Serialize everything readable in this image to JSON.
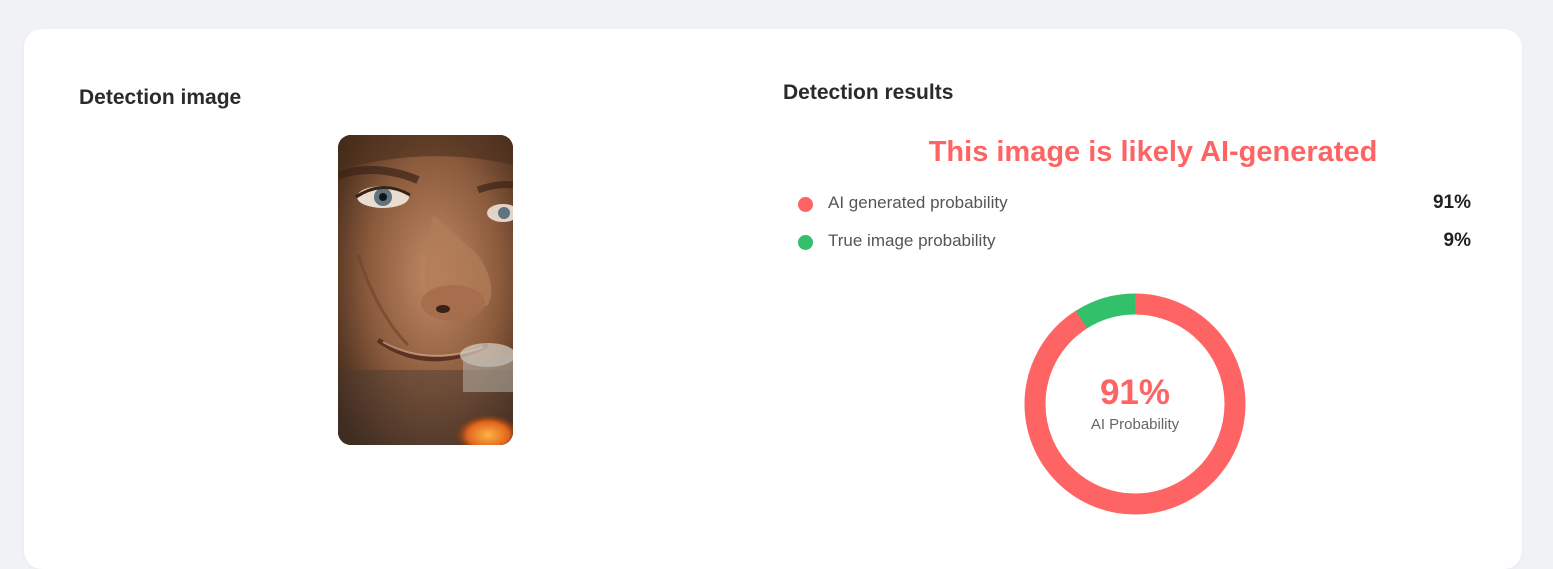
{
  "left_panel": {
    "title": "Detection image",
    "image_icon": "portrait-photo-icon"
  },
  "right_panel": {
    "title": "Detection results",
    "verdict": "This image is likely AI-generated",
    "rows": [
      {
        "label": "AI generated probability",
        "value": "91%",
        "color": "#fe6464"
      },
      {
        "label": "True image probability",
        "value": "9%",
        "color": "#33c06b"
      }
    ]
  },
  "donut": {
    "center_value": "91%",
    "center_label": "AI Probability",
    "ai_fraction": 0.91,
    "true_fraction": 0.09
  },
  "colors": {
    "accent": "#fe6464",
    "true": "#33c06b",
    "background": "#f1f2f6",
    "card": "#ffffff"
  }
}
